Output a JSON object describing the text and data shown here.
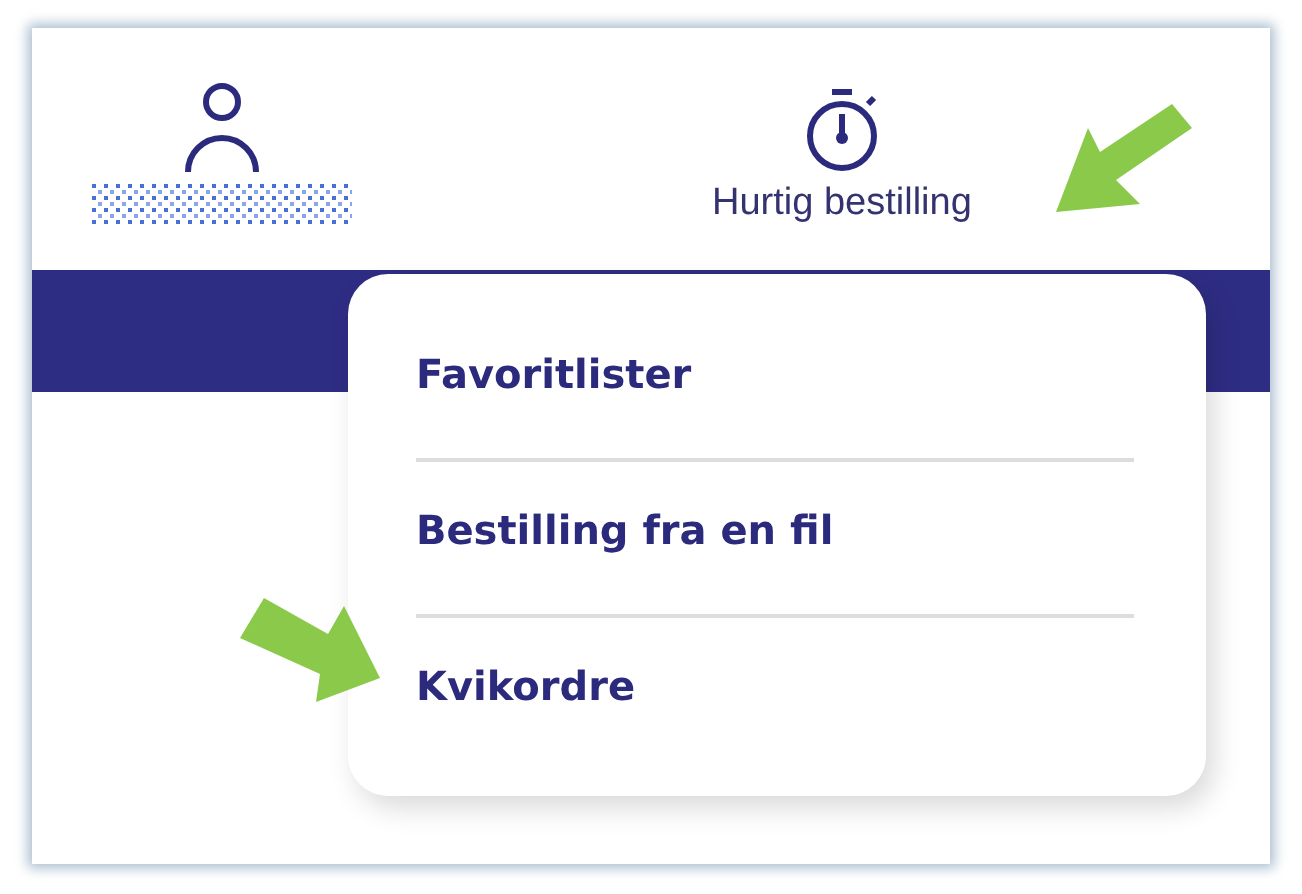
{
  "header": {
    "quick_order": {
      "label": "Hurtig bestilling"
    }
  },
  "dropdown_menu": {
    "items": [
      {
        "label": "Favoritlister"
      },
      {
        "label": "Bestilling fra en fil"
      },
      {
        "label": "Kvikordre"
      }
    ]
  }
}
